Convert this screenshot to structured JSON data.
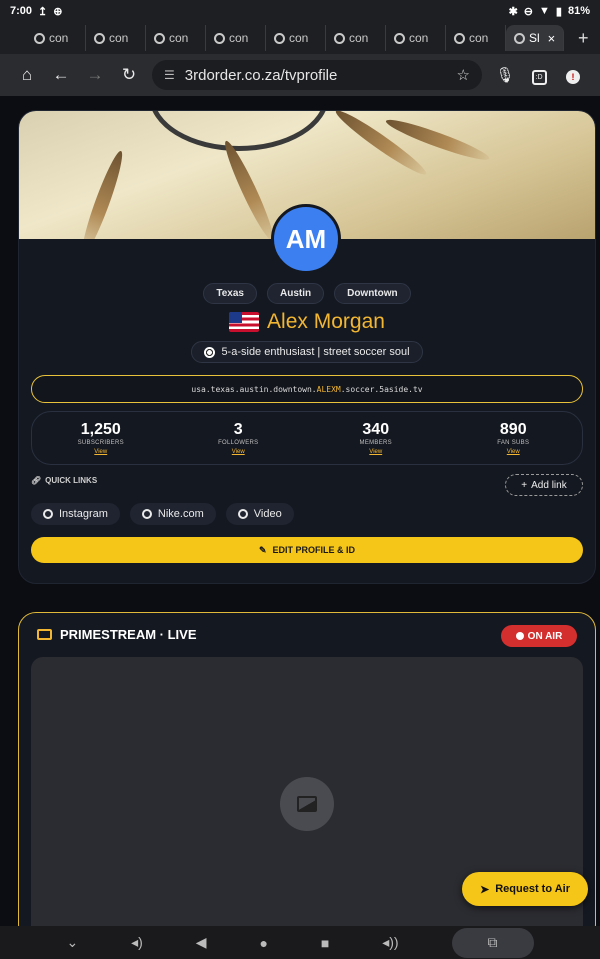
{
  "status_bar": {
    "time": "7:00",
    "battery": "81%"
  },
  "tabs": [
    {
      "label": "con"
    },
    {
      "label": "con"
    },
    {
      "label": "con"
    },
    {
      "label": "con"
    },
    {
      "label": "con"
    },
    {
      "label": "con"
    },
    {
      "label": "con"
    },
    {
      "label": "con"
    }
  ],
  "active_tab": {
    "label": "Sl"
  },
  "address_bar": {
    "url": "3rdorder.co.za/tvprofile"
  },
  "profile": {
    "initials": "AM",
    "locations": [
      "Texas",
      "Austin",
      "Downtown"
    ],
    "name": "Alex Morgan",
    "bio": "5-a-side enthusiast | street soccer soul",
    "tv_id_prefix": "usa.texas.austin.downtown.",
    "tv_id_highlight": "ALEXM",
    "tv_id_suffix": ".soccer.5aside.tv",
    "stats": [
      {
        "value": "1,250",
        "label": "SUBSCRIBERS",
        "link": "View"
      },
      {
        "value": "3",
        "label": "FOLLOWERS",
        "link": "View"
      },
      {
        "value": "340",
        "label": "MEMBERS",
        "link": "View"
      },
      {
        "value": "890",
        "label": "FAN SUBS",
        "link": "View"
      }
    ],
    "quick_links_label": "QUICK LINKS",
    "add_link_label": "Add link",
    "links": [
      "Instagram",
      "Nike.com",
      "Video"
    ],
    "edit_button": "EDIT PROFILE & ID"
  },
  "stream": {
    "title": "PRIMESTREAM · LIVE",
    "status": "ON AIR"
  },
  "request_button": "Request to Air",
  "colors": {
    "accent": "#f5c518",
    "on_air": "#d32f2f",
    "avatar": "#3b7ff0"
  }
}
